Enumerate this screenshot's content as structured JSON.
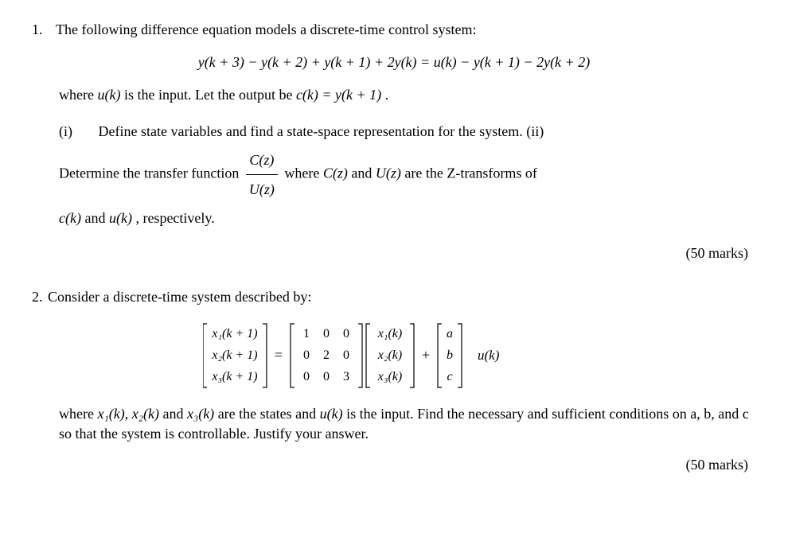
{
  "q1": {
    "number": "1.",
    "intro": "The following difference equation models a discrete-time control system:",
    "equation": "y(k + 3) − y(k + 2) + y(k + 1) + 2y(k) = u(k) − y(k + 1) − 2y(k + 2)",
    "where_text_pre": "where ",
    "where_uk": "u(k)",
    "where_text_mid": " is the input. Let the output be ",
    "where_ck": "c(k) = y(k + 1)",
    "where_text_end": " .",
    "part_i_label": "(i)",
    "part_i_text": "Define state variables and find a state-space representation for the system. (ii)",
    "part_ii_pre": "Determine the transfer function ",
    "frac_num": "C(z)",
    "frac_den": "U(z)",
    "part_ii_mid": " where ",
    "cz": "C(z)",
    "and1": " and ",
    "uz": "U(z)",
    "part_ii_tail": " are the Z-transforms of",
    "part_ii_line2_ck": "c(k)",
    "part_ii_line2_mid": " and ",
    "part_ii_line2_uk": "u(k)",
    "part_ii_line2_end": " , respectively.",
    "marks": "(50 marks)"
  },
  "q2": {
    "number": "2.",
    "intro": "Consider a discrete-time system described by:",
    "matrix": {
      "lhs_rows": [
        "x₁(k + 1)",
        "x₂(k + 1)",
        "x₃(k + 1)"
      ],
      "A": [
        [
          "1",
          "0",
          "0"
        ],
        [
          "0",
          "2",
          "0"
        ],
        [
          "0",
          "0",
          "3"
        ]
      ],
      "x_rows": [
        "x₁(k)",
        "x₂(k)",
        "x₃(k)"
      ],
      "B": [
        "a",
        "b",
        "c"
      ],
      "u": "u(k)"
    },
    "where_pre": "where ",
    "x1": "x₁(k)",
    "comma1": ", ",
    "x2": "x₂(k)",
    "and": " and ",
    "x3": "x₃(k)",
    "where_mid": " are the states and ",
    "uk": "u(k)",
    "where_tail": " is the input. Find the necessary and sufficient conditions on a, b, and c so that the system is controllable. Justify your answer.",
    "marks": "(50 marks)"
  }
}
